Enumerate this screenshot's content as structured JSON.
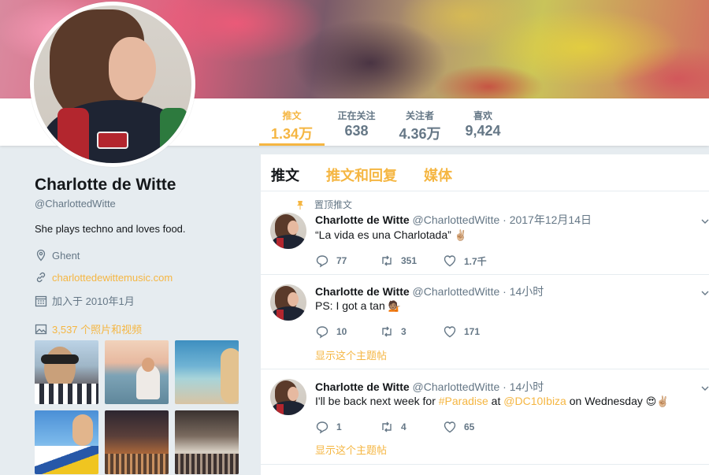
{
  "profile": {
    "name": "Charlotte de Witte",
    "handle": "@CharlottedWitte",
    "bio": "She plays techno and loves food.",
    "location": "Ghent",
    "website": "charlottedewittemusic.com",
    "joined": "加入于 2010年1月",
    "photos": "3,537 个照片和视频"
  },
  "stats": [
    {
      "label": "推文",
      "value": "1.34万"
    },
    {
      "label": "正在关注",
      "value": "638"
    },
    {
      "label": "关注者",
      "value": "4.36万"
    },
    {
      "label": "喜欢",
      "value": "9,424"
    }
  ],
  "tabs": [
    "推文",
    "推文和回复",
    "媒体"
  ],
  "tweets": [
    {
      "pinned_label": "置顶推文",
      "name": "Charlotte de Witte",
      "handle": "@CharlottedWitte",
      "time": "· 2017年12月14日",
      "text": "“La vida es una Charlotada”",
      "emoji": "✌🏼",
      "replies": "77",
      "retweets": "351",
      "likes": "1.7千"
    },
    {
      "name": "Charlotte de Witte",
      "handle": "@CharlottedWitte",
      "time": "· 14小时",
      "text": "PS: I got a tan",
      "emoji": "💁🏽",
      "replies": "10",
      "retweets": "3",
      "likes": "171",
      "thread": "显示这个主题帖"
    },
    {
      "name": "Charlotte de Witte",
      "handle": "@CharlottedWitte",
      "time": "· 14小时",
      "text_pre": "I'll be back next week for ",
      "hashtag": "#Paradise",
      "text_mid": " at ",
      "mention": "@DC10Ibiza",
      "text_post": " on Wednesday ",
      "emoji": "😍✌🏼",
      "replies": "1",
      "retweets": "4",
      "likes": "65",
      "thread": "显示这个主题帖"
    }
  ],
  "colors": {
    "accent": "#f5b642",
    "text": "#14171a",
    "muted": "#657786",
    "background": "#e6ecf0"
  }
}
